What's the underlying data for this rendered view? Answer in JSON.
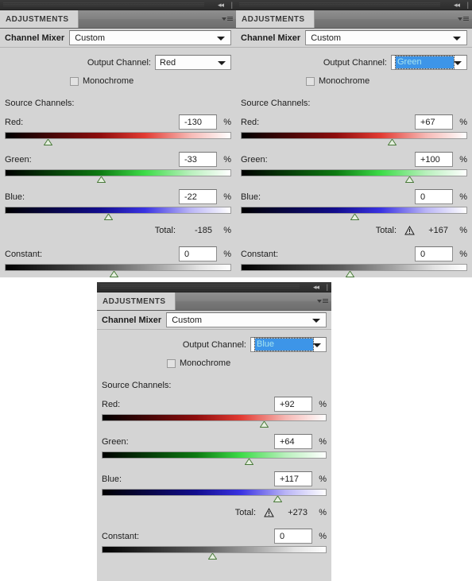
{
  "app": {
    "panel_tab_label": "ADJUSTMENTS",
    "adjustment_title": "Channel Mixer",
    "preset_value": "Custom",
    "output_channel_label": "Output Channel:",
    "monochrome_label": "Monochrome",
    "source_channels_label": "Source Channels:",
    "red_label": "Red:",
    "green_label": "Green:",
    "blue_label": "Blue:",
    "total_label": "Total:",
    "constant_label": "Constant:",
    "percent_symbol": "%",
    "collapse_icon": "collapse-to-icons-icon",
    "panel_menu_icon": "panel-menu-icon",
    "warning_icon": "warning-triangle-icon"
  },
  "colors": {
    "panel_bg": "#d4d4d4",
    "tab_bar": "#828282",
    "dock_bar": "#333333",
    "highlight": "#3d95e8",
    "highlight_text": "#a6e4ef",
    "thumb_fill": "#e6f0e0",
    "thumb_stroke": "#4a7a3a"
  },
  "panels": [
    {
      "id": "red-output-panel",
      "output_channel": "Red",
      "output_selected": false,
      "monochrome_checked": false,
      "channels": [
        {
          "name": "red",
          "label": "Red:",
          "value": "-130",
          "pos_pct": 19.0
        },
        {
          "name": "green",
          "label": "Green:",
          "value": "-33",
          "pos_pct": 42.5
        },
        {
          "name": "blue",
          "label": "Blue:",
          "value": "-22",
          "pos_pct": 45.5
        }
      ],
      "total": {
        "value": "-185",
        "warning": false
      },
      "constant": {
        "value": "0",
        "pos_pct": 48.0
      }
    },
    {
      "id": "green-output-panel",
      "output_channel": "Green",
      "output_selected": true,
      "monochrome_checked": false,
      "channels": [
        {
          "name": "red",
          "label": "Red:",
          "value": "+67",
          "pos_pct": 66.5
        },
        {
          "name": "green",
          "label": "Green:",
          "value": "+100",
          "pos_pct": 74.5
        },
        {
          "name": "blue",
          "label": "Blue:",
          "value": "0",
          "pos_pct": 50.0
        }
      ],
      "total": {
        "value": "+167",
        "warning": true
      },
      "constant": {
        "value": "0",
        "pos_pct": 48.0
      }
    },
    {
      "id": "blue-output-panel",
      "output_channel": "Blue",
      "output_selected": true,
      "monochrome_checked": false,
      "channels": [
        {
          "name": "red",
          "label": "Red:",
          "value": "+92",
          "pos_pct": 72.0
        },
        {
          "name": "green",
          "label": "Green:",
          "value": "+64",
          "pos_pct": 65.5
        },
        {
          "name": "blue",
          "label": "Blue:",
          "value": "+117",
          "pos_pct": 78.0
        }
      ],
      "total": {
        "value": "+273",
        "warning": true
      },
      "constant": {
        "value": "0",
        "pos_pct": 49.0
      }
    }
  ]
}
